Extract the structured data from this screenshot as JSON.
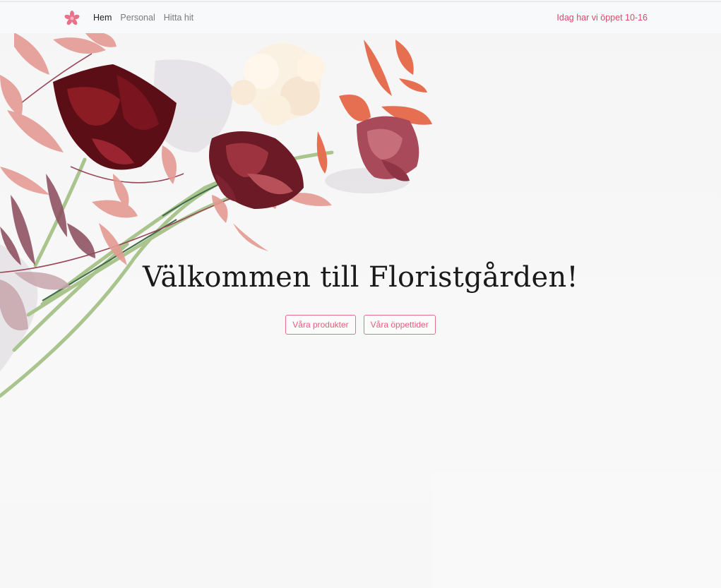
{
  "navbar": {
    "brand_icon": "flower-logo-icon",
    "links": [
      {
        "label": "Hem",
        "active": true
      },
      {
        "label": "Personal",
        "active": false
      },
      {
        "label": "Hitta hit",
        "active": false
      }
    ],
    "open_text": "Idag har vi öppet 10-16"
  },
  "hero": {
    "title": "Välkommen till Floristgården!",
    "buttons": [
      {
        "label": "Våra produkter"
      },
      {
        "label": "Våra öppettider"
      }
    ]
  },
  "colors": {
    "accent": "#e0607e",
    "open_text": "#d94a6a",
    "navbar_bg": "#f8f9fa"
  }
}
